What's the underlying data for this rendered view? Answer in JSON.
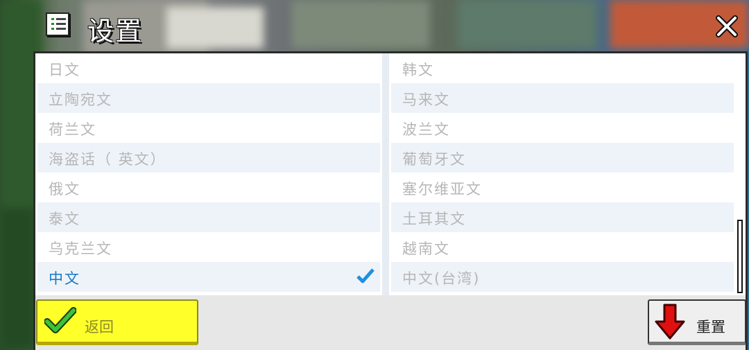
{
  "header": {
    "title": "设置",
    "title_icon": "checklist-icon",
    "close_icon": "close-icon"
  },
  "languages": {
    "left": [
      {
        "label": "日文"
      },
      {
        "label": "立陶宛文"
      },
      {
        "label": "荷兰文"
      },
      {
        "label": "海盗话（ 英文）"
      },
      {
        "label": "俄文"
      },
      {
        "label": "泰文"
      },
      {
        "label": "乌克兰文"
      },
      {
        "label": "中文",
        "selected": true
      }
    ],
    "right": [
      {
        "label": "韩文"
      },
      {
        "label": "马来文"
      },
      {
        "label": "波兰文"
      },
      {
        "label": "葡萄牙文"
      },
      {
        "label": "塞尔维亚文"
      },
      {
        "label": "土耳其文"
      },
      {
        "label": "越南文"
      },
      {
        "label": "中文(台湾)"
      }
    ]
  },
  "footer": {
    "back_label": "返回",
    "reset_label": "重置"
  },
  "colors": {
    "selected_text": "#1478c8",
    "back_button": "#ffff2a",
    "reset_arrow": "#e01010"
  }
}
